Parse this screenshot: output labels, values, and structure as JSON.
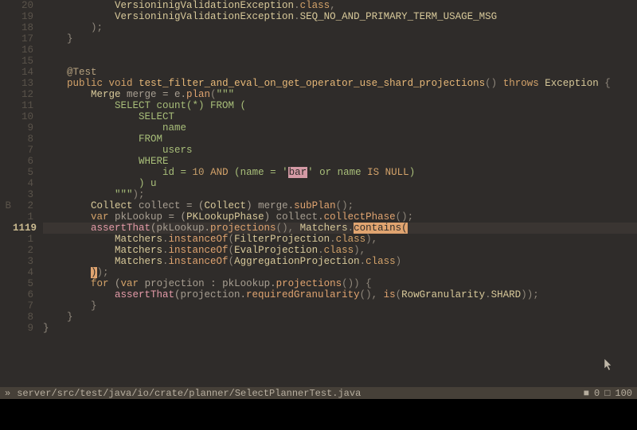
{
  "marks": {
    "2": "B"
  },
  "cursor_line_index": 21,
  "rows": [
    {
      "g1": "",
      "g2": "20",
      "tokens": [
        [
          "            ",
          ""
        ],
        [
          "VersioninigValidationException",
          "type"
        ],
        [
          ".",
          "punc"
        ],
        [
          "class",
          "kw"
        ],
        [
          ",",
          "punc"
        ]
      ]
    },
    {
      "g1": "",
      "g2": "19",
      "tokens": [
        [
          "            ",
          ""
        ],
        [
          "VersioninigValidationException",
          "type"
        ],
        [
          ".",
          "punc"
        ],
        [
          "SEQ_NO_AND_PRIMARY_TERM_USAGE_MSG",
          "type"
        ]
      ]
    },
    {
      "g1": "",
      "g2": "18",
      "tokens": [
        [
          "        );",
          "punc"
        ]
      ]
    },
    {
      "g1": "",
      "g2": "17",
      "tokens": [
        [
          "    }",
          "punc"
        ]
      ]
    },
    {
      "g1": "",
      "g2": "16",
      "tokens": [
        [
          "",
          ""
        ]
      ]
    },
    {
      "g1": "",
      "g2": "15",
      "tokens": [
        [
          "",
          ""
        ]
      ]
    },
    {
      "g1": "",
      "g2": "14",
      "tokens": [
        [
          "    ",
          ""
        ],
        [
          "@Test",
          "ann"
        ]
      ]
    },
    {
      "g1": "",
      "g2": "13",
      "tokens": [
        [
          "    ",
          ""
        ],
        [
          "public",
          "kw"
        ],
        [
          " ",
          ""
        ],
        [
          "void",
          "kw"
        ],
        [
          " ",
          ""
        ],
        [
          "test_filter_and_eval_on_get_operator_use_shard_projections",
          "fn"
        ],
        [
          "()",
          "punc"
        ],
        [
          " ",
          ""
        ],
        [
          "throws",
          "kw"
        ],
        [
          " ",
          ""
        ],
        [
          "Exception",
          "type"
        ],
        [
          " {",
          "punc"
        ]
      ]
    },
    {
      "g1": "",
      "g2": "12",
      "tokens": [
        [
          "        ",
          ""
        ],
        [
          "Merge",
          "type"
        ],
        [
          " merge = e.",
          ""
        ],
        [
          "plan",
          "meth"
        ],
        [
          "(",
          "punc"
        ],
        [
          "\"\"\"",
          "str"
        ]
      ]
    },
    {
      "g1": "",
      "g2": "11",
      "tokens": [
        [
          "            ",
          ""
        ],
        [
          "SELECT count(*) FROM (",
          "str"
        ]
      ]
    },
    {
      "g1": "",
      "g2": "10",
      "tokens": [
        [
          "                ",
          ""
        ],
        [
          "SELECT",
          "str"
        ]
      ]
    },
    {
      "g1": "",
      "g2": "9",
      "tokens": [
        [
          "                    ",
          ""
        ],
        [
          "name",
          "str"
        ]
      ]
    },
    {
      "g1": "",
      "g2": "8",
      "tokens": [
        [
          "                ",
          ""
        ],
        [
          "FROM",
          "str"
        ]
      ]
    },
    {
      "g1": "",
      "g2": "7",
      "tokens": [
        [
          "                    ",
          ""
        ],
        [
          "users",
          "str"
        ]
      ]
    },
    {
      "g1": "",
      "g2": "6",
      "tokens": [
        [
          "                ",
          ""
        ],
        [
          "WHERE",
          "str"
        ]
      ]
    },
    {
      "g1": "",
      "g2": "5",
      "tokens": [
        [
          "                    ",
          ""
        ],
        [
          "id = ",
          "str"
        ],
        [
          "10",
          "num"
        ],
        [
          " ",
          "str"
        ],
        [
          "AND",
          "kw"
        ],
        [
          " (name = ",
          "str"
        ],
        [
          "'",
          "str"
        ],
        [
          "bar",
          "search"
        ],
        [
          "'",
          "str"
        ],
        [
          " or name ",
          "str"
        ],
        [
          "IS NULL",
          "kw"
        ],
        [
          ")",
          "str"
        ]
      ]
    },
    {
      "g1": "",
      "g2": "4",
      "tokens": [
        [
          "                ",
          ""
        ],
        [
          ") u",
          "str"
        ]
      ]
    },
    {
      "g1": "",
      "g2": "3",
      "tokens": [
        [
          "            ",
          ""
        ],
        [
          "\"\"\"",
          "str"
        ],
        [
          ");",
          "punc"
        ]
      ]
    },
    {
      "g1": "B",
      "g2": "2",
      "tokens": [
        [
          "        ",
          ""
        ],
        [
          "Collect",
          "type"
        ],
        [
          " collect = (",
          ""
        ],
        [
          "Collect",
          "type"
        ],
        [
          ") merge.",
          ""
        ],
        [
          "subPlan",
          "meth"
        ],
        [
          "();",
          "punc"
        ]
      ]
    },
    {
      "g1": "",
      "g2": "1",
      "tokens": [
        [
          "        ",
          ""
        ],
        [
          "var",
          "kw"
        ],
        [
          " pkLookup = (",
          ""
        ],
        [
          "PKLookupPhase",
          "type"
        ],
        [
          ") collect.",
          ""
        ],
        [
          "collectPhase",
          "meth"
        ],
        [
          "();",
          "punc"
        ]
      ]
    },
    {
      "g1": "",
      "g2": "1119",
      "cursor": true,
      "tokens": [
        [
          "        ",
          ""
        ],
        [
          "assertThat",
          "pink"
        ],
        [
          "(pkLookup.",
          ""
        ],
        [
          "projections",
          "meth"
        ],
        [
          "(), ",
          "punc"
        ],
        [
          "Matchers",
          "type"
        ],
        [
          ".",
          "punc"
        ],
        [
          "contains(",
          "hi"
        ]
      ]
    },
    {
      "g1": "",
      "g2": "1",
      "tokens": [
        [
          "            ",
          ""
        ],
        [
          "Matchers",
          "type"
        ],
        [
          ".",
          "punc"
        ],
        [
          "instanceOf",
          "meth"
        ],
        [
          "(",
          "punc"
        ],
        [
          "FilterProjection",
          "type"
        ],
        [
          ".",
          "punc"
        ],
        [
          "class",
          "kw"
        ],
        [
          "),",
          "punc"
        ]
      ]
    },
    {
      "g1": "",
      "g2": "2",
      "tokens": [
        [
          "            ",
          ""
        ],
        [
          "Matchers",
          "type"
        ],
        [
          ".",
          "punc"
        ],
        [
          "instanceOf",
          "meth"
        ],
        [
          "(",
          "punc"
        ],
        [
          "EvalProjection",
          "type"
        ],
        [
          ".",
          "punc"
        ],
        [
          "class",
          "kw"
        ],
        [
          "),",
          "punc"
        ]
      ]
    },
    {
      "g1": "",
      "g2": "3",
      "tokens": [
        [
          "            ",
          ""
        ],
        [
          "Matchers",
          "type"
        ],
        [
          ".",
          "punc"
        ],
        [
          "instanceOf",
          "meth"
        ],
        [
          "(",
          "punc"
        ],
        [
          "AggregationProjection",
          "type"
        ],
        [
          ".",
          "punc"
        ],
        [
          "class",
          "kw"
        ],
        [
          ")",
          "punc"
        ]
      ]
    },
    {
      "g1": "",
      "g2": "4",
      "tokens": [
        [
          "        ",
          ""
        ],
        [
          ")",
          "hi"
        ],
        [
          ");",
          "punc"
        ]
      ]
    },
    {
      "g1": "",
      "g2": "5",
      "tokens": [
        [
          "        ",
          ""
        ],
        [
          "for",
          "kw"
        ],
        [
          " (",
          ""
        ],
        [
          "var",
          "kw"
        ],
        [
          " projection : pkLookup.",
          ""
        ],
        [
          "projections",
          "meth"
        ],
        [
          "()) {",
          "punc"
        ]
      ]
    },
    {
      "g1": "",
      "g2": "6",
      "tokens": [
        [
          "            ",
          ""
        ],
        [
          "assertThat",
          "pink"
        ],
        [
          "(projection.",
          ""
        ],
        [
          "requiredGranularity",
          "meth"
        ],
        [
          "(), ",
          "punc"
        ],
        [
          "is",
          "meth"
        ],
        [
          "(",
          "punc"
        ],
        [
          "RowGranularity",
          "type"
        ],
        [
          ".",
          "punc"
        ],
        [
          "SHARD",
          "type"
        ],
        [
          "));",
          "punc"
        ]
      ]
    },
    {
      "g1": "",
      "g2": "7",
      "tokens": [
        [
          "        }",
          "punc"
        ]
      ]
    },
    {
      "g1": "",
      "g2": "8",
      "tokens": [
        [
          "    }",
          "punc"
        ]
      ]
    },
    {
      "g1": "",
      "g2": "9",
      "tokens": [
        [
          "}",
          "punc"
        ]
      ]
    }
  ],
  "statusbar": {
    "prefix": "»",
    "path": "server/src/test/java/io/crate/planner/SelectPlannerTest.java",
    "diag_error_icon": "■",
    "diag_error_count": "0",
    "diag_warn_icon": "□",
    "diag_warn_count": "100"
  }
}
